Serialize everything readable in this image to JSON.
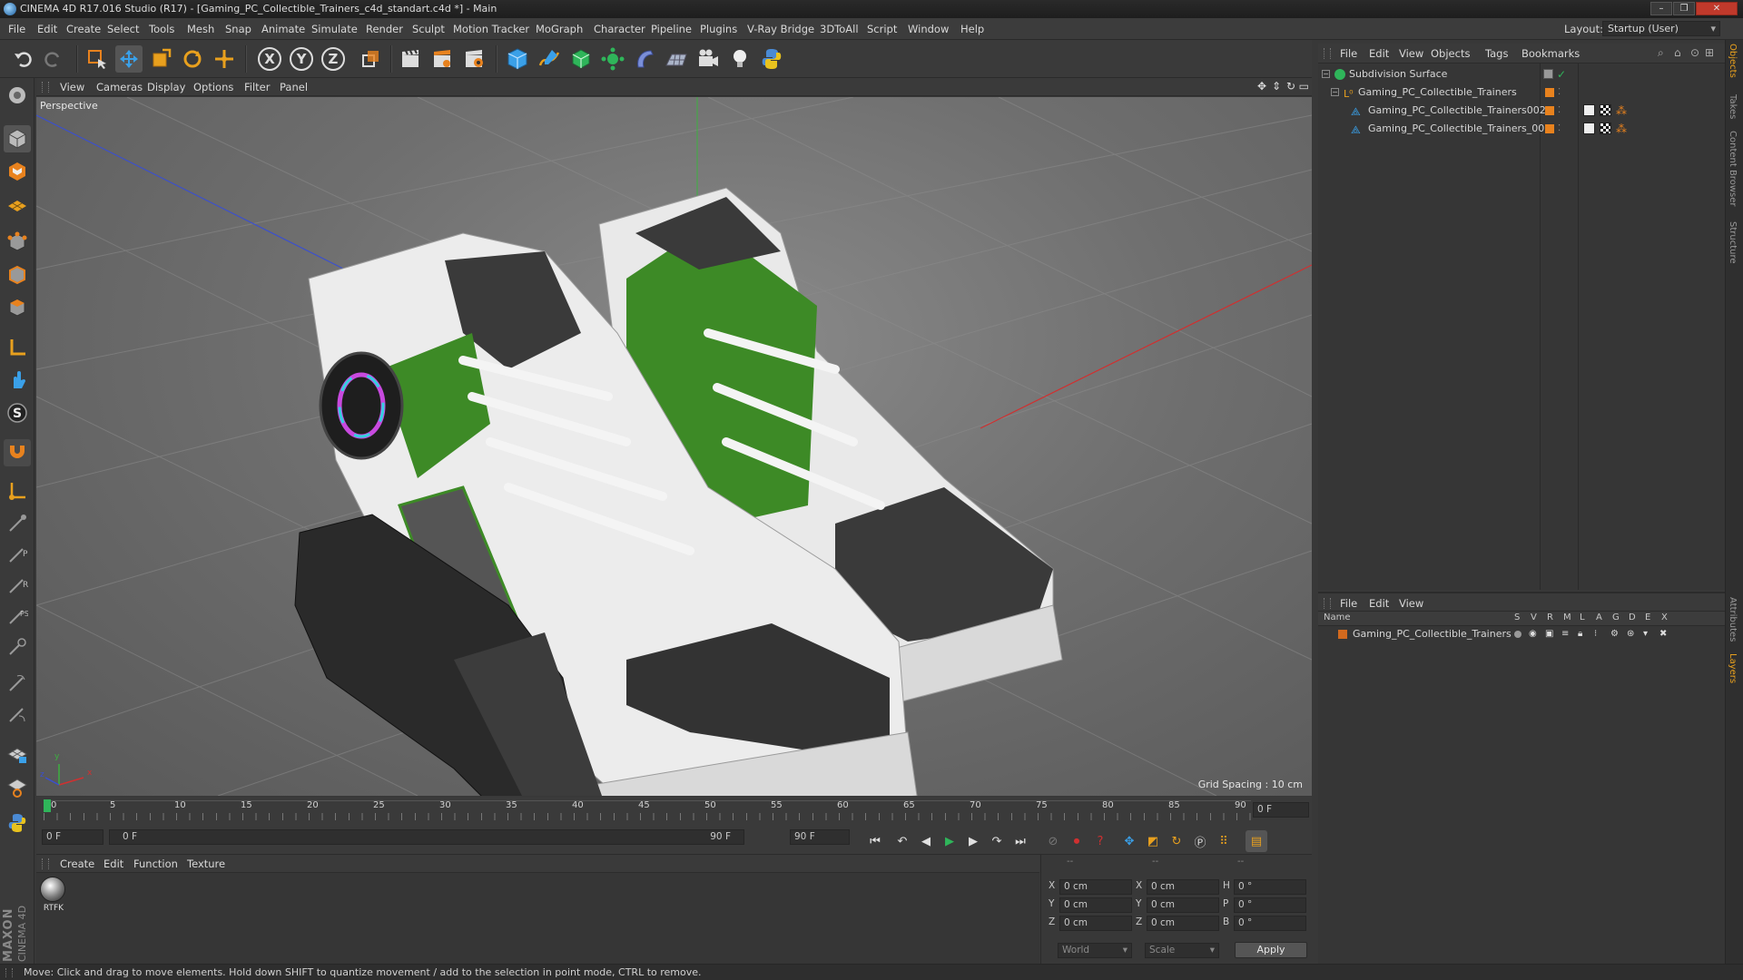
{
  "window": {
    "title": "CINEMA 4D R17.016 Studio (R17) - [Gaming_PC_Collectible_Trainers_c4d_standart.c4d *] - Main"
  },
  "menubar": {
    "items": [
      "File",
      "Edit",
      "Create",
      "Select",
      "Tools",
      "Mesh",
      "Snap",
      "Animate",
      "Simulate",
      "Render",
      "Sculpt",
      "Motion Tracker",
      "MoGraph",
      "Character",
      "Pipeline",
      "Plugins",
      "V-Ray Bridge",
      "3DToAll",
      "Script",
      "Window",
      "Help"
    ],
    "layout_label": "Layout:",
    "layout_value": "Startup (User)"
  },
  "toolbar": {
    "axis_x": "X",
    "axis_y": "Y",
    "axis_z": "Z"
  },
  "viewport": {
    "menu": [
      "View",
      "Cameras",
      "Display",
      "Options",
      "Filter",
      "Panel"
    ],
    "camera_label": "Perspective",
    "grid_spacing": "Grid Spacing : 10 cm",
    "axis_x": "x",
    "axis_y": "y",
    "axis_z": "z"
  },
  "timeline": {
    "ticks": [
      "0",
      "5",
      "10",
      "15",
      "20",
      "25",
      "30",
      "35",
      "40",
      "45",
      "50",
      "55",
      "60",
      "65",
      "70",
      "75",
      "80",
      "85",
      "90"
    ],
    "current_frame": "0 F",
    "start_field": "0 F",
    "range_start": "0 F",
    "range_end": "90 F",
    "end_field": "90 F"
  },
  "material_manager": {
    "menu": [
      "Create",
      "Edit",
      "Function",
      "Texture"
    ],
    "materials": [
      {
        "name": "RTFK"
      }
    ]
  },
  "maxon": {
    "line1": "MAXON",
    "line2": "CINEMA 4D"
  },
  "coordinates": {
    "headers": [
      "--",
      "--",
      "--"
    ],
    "rows": [
      {
        "a": "X",
        "a_val": "0 cm",
        "b": "X",
        "b_val": "0 cm",
        "c": "H",
        "c_val": "0 °"
      },
      {
        "a": "Y",
        "a_val": "0 cm",
        "b": "Y",
        "b_val": "0 cm",
        "c": "P",
        "c_val": "0 °"
      },
      {
        "a": "Z",
        "a_val": "0 cm",
        "b": "Z",
        "b_val": "0 cm",
        "c": "B",
        "c_val": "0 °"
      }
    ],
    "mode_world": "World",
    "mode_scale": "Scale",
    "apply": "Apply"
  },
  "object_manager": {
    "menu": [
      "File",
      "Edit",
      "View",
      "Objects",
      "Tags",
      "Bookmarks"
    ],
    "objects": [
      {
        "name": "Subdivision Surface",
        "indent": 0
      },
      {
        "name": "Gaming_PC_Collectible_Trainers",
        "indent": 1
      },
      {
        "name": "Gaming_PC_Collectible_Trainers002",
        "indent": 2
      },
      {
        "name": "Gaming_PC_Collectible_Trainers_001",
        "indent": 2
      }
    ]
  },
  "layer_manager": {
    "menu": [
      "File",
      "Edit",
      "View"
    ],
    "header": {
      "name": "Name",
      "cols": [
        "S",
        "V",
        "R",
        "M",
        "L",
        "A",
        "G",
        "D",
        "E",
        "X"
      ]
    },
    "layers": [
      {
        "name": "Gaming_PC_Collectible_Trainers",
        "color": "#d2691e"
      }
    ]
  },
  "side_tabs": [
    "Objects",
    "Takes",
    "Content Browser",
    "Structure",
    "Attributes",
    "Layers"
  ],
  "status": {
    "text": "Move: Click and drag to move elements. Hold down SHIFT to quantize movement / add to the selection in point mode, CTRL to remove."
  },
  "colors": {
    "accent_orange": "#e8821e",
    "accent_blue": "#3aa0e8",
    "shoe_green": "#3d8a26",
    "layer_orange": "#d2691e"
  }
}
